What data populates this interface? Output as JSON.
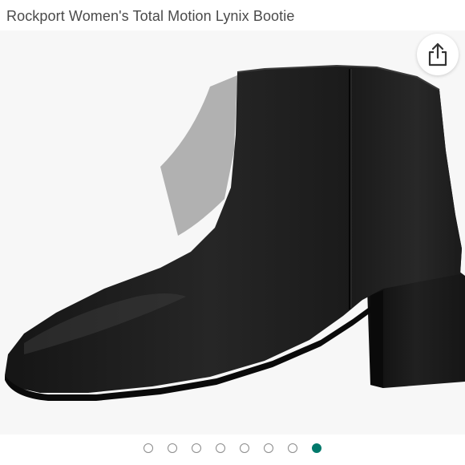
{
  "product": {
    "title": "Rockport Women's Total Motion Lynix Bootie"
  },
  "image": {
    "description_icon": "boot-image"
  },
  "share": {
    "icon": "share-icon"
  },
  "carousel": {
    "total_images": 8,
    "active_index": 8,
    "active_color": "#00796b",
    "inactive_color": "#8a8a8a"
  },
  "colors": {
    "title_text": "#4a4a4a",
    "image_background": "#f7f7f7",
    "boot": "#1a1a1a"
  }
}
